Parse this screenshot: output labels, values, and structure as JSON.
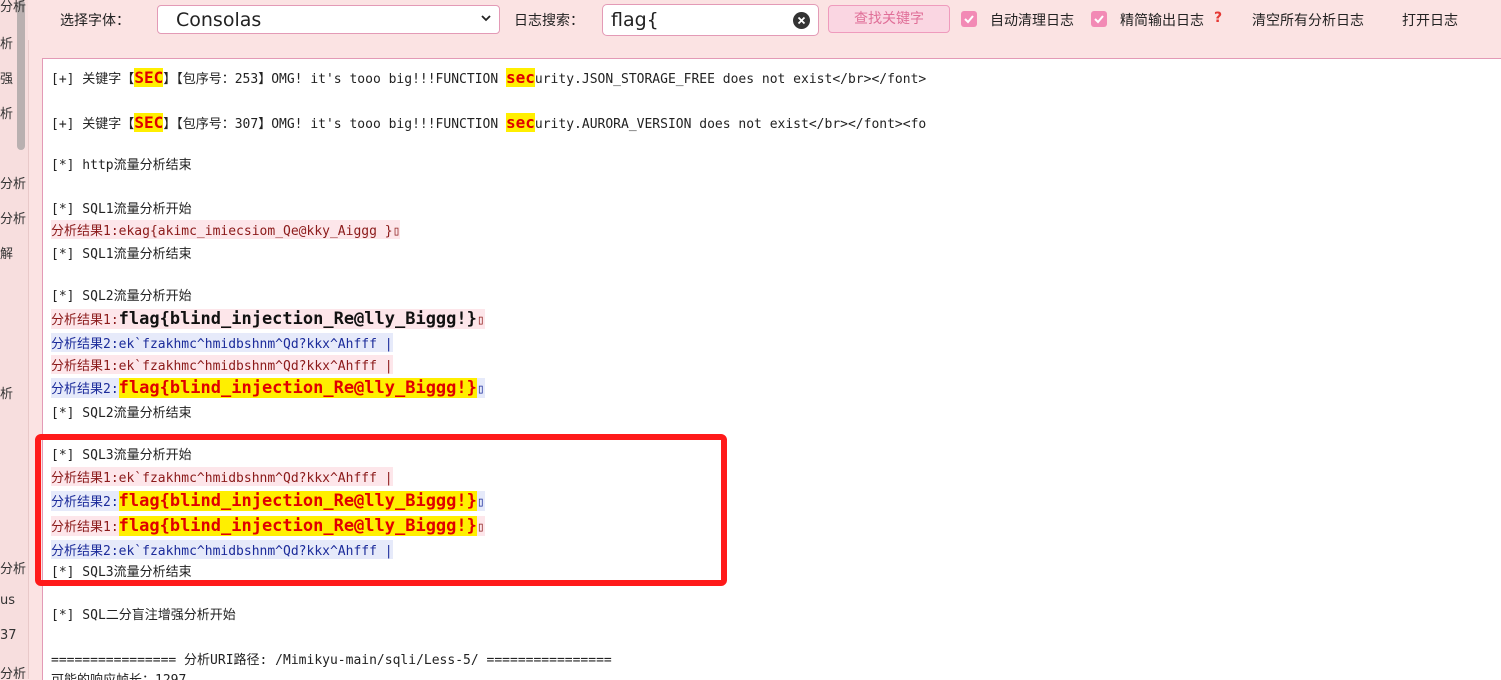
{
  "sidebar": {
    "items": [
      "分析",
      "析",
      "强",
      "析",
      "分析",
      "分析",
      "解",
      "析",
      "分析",
      "us",
      "37",
      "分析"
    ]
  },
  "toolbar": {
    "font_label": "选择字体：",
    "font_value": "Consolas",
    "search_label": "日志搜索：",
    "search_value": "flag{",
    "find_button": "查找关键字",
    "auto_clean_label": "自动清理日志",
    "auto_clean_checked": true,
    "compact_label": "精简输出日志",
    "compact_checked": true,
    "help_icon": "?",
    "clear_logs_button": "清空所有分析日志",
    "open_log_button": "打开日志"
  },
  "colors": {
    "background": "#fbe3e3",
    "accent": "#f28ab5",
    "keyword_bg": "#ffef00",
    "keyword_fg": "#e00000",
    "result1": "#8b1a1a",
    "result2": "#1b2b9a",
    "highlight_box": "#ff1a1a"
  },
  "log": {
    "kw_lines": [
      {
        "prefix": "[+] 关键字【",
        "kw": "SEC",
        "mid": "】【包序号：253】OMG! it's tooo big!!!FUNCTION ",
        "kw2": "sec",
        "rest": "urity.JSON_STORAGE_FREE does not exist</br></font>"
      },
      {
        "prefix": "[+] 关键字【",
        "kw": "SEC",
        "mid": "】【包序号：307】OMG! it's tooo big!!!FUNCTION ",
        "kw2": "sec",
        "rest": "urity.AURORA_VERSION does not exist</br></font><fo"
      }
    ],
    "http_end": "[*] http流量分析结束",
    "sql1_start": "[*] SQL1流量分析开始",
    "sql1_r1_label": "分析结果1:",
    "sql1_r1_value": "ekag{akimc_imiecsiom_Qe@kky_Aiggg }",
    "sql1_end": "[*] SQL1流量分析结束",
    "sql2_start": "[*] SQL2流量分析开始",
    "sql2_r1_label": "分析结果1:",
    "sql2_r1_value": "flag{blind_injection_Re@lly_Biggg!}",
    "sql2_r2a": "分析结果2:ek`fzakhmc^hmidbshnm^Qd?kkx^Ahfff |",
    "sql2_r1b": "分析结果1:ek`fzakhmc^hmidbshnm^Qd?kkx^Ahfff |",
    "sql2_r2b_label": "分析结果2:",
    "sql2_r2b_value": "flag{blind_injection_Re@lly_Biggg!}",
    "sql2_end": "[*] SQL2流量分析结束",
    "sql3_start": "[*] SQL3流量分析开始",
    "sql3_r1a": "分析结果1:ek`fzakhmc^hmidbshnm^Qd?kkx^Ahfff |",
    "sql3_r2a_label": "分析结果2:",
    "sql3_r2a_value": "flag{blind_injection_Re@lly_Biggg!}",
    "sql3_r1b_label": "分析结果1:",
    "sql3_r1b_value": "flag{blind_injection_Re@lly_Biggg!}",
    "sql3_r2b": "分析结果2:ek`fzakhmc^hmidbshnm^Qd?kkx^Ahfff |",
    "sql3_end": "[*] SQL3流量分析结束",
    "sql_enhance_start": "[*] SQL二分盲注增强分析开始",
    "uri_line": "================ 分析URI路径: /Mimikyu-main/sqli/Less-5/ ================",
    "resp_len": "可能的响应帧长：1297",
    "trail_mark": "▯"
  }
}
